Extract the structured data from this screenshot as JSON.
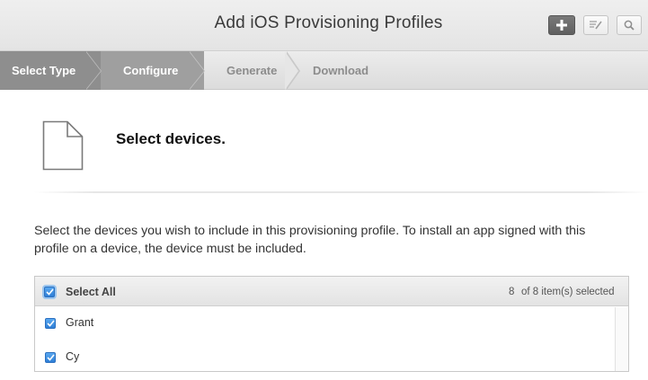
{
  "header": {
    "title": "Add iOS Provisioning Profiles",
    "buttons": [
      {
        "icon": "plus-icon"
      },
      {
        "icon": "edit-icon"
      },
      {
        "icon": "search-icon"
      }
    ]
  },
  "steps": [
    {
      "label": "Select Type",
      "state": "done"
    },
    {
      "label": "Configure",
      "state": "active"
    },
    {
      "label": "Generate",
      "state": "upcoming"
    },
    {
      "label": "Download",
      "state": "upcoming"
    }
  ],
  "section": {
    "icon": "document-icon",
    "title": "Select devices."
  },
  "description": "Select the devices you wish to include in this provisioning profile. To install an app signed with this profile on a device, the device must be included.",
  "devices": {
    "select_all_label": "Select All",
    "select_all_checked": true,
    "selected_count": "8",
    "selected_suffix": "of 8 item(s) selected",
    "rows": [
      {
        "name": "Grant",
        "checked": true
      },
      {
        "name": "Cy",
        "checked": true
      }
    ]
  },
  "colors": {
    "checkbox": "#2f7fd6",
    "step_done": "#8e8e8e",
    "step_active": "#9f9f9f"
  }
}
